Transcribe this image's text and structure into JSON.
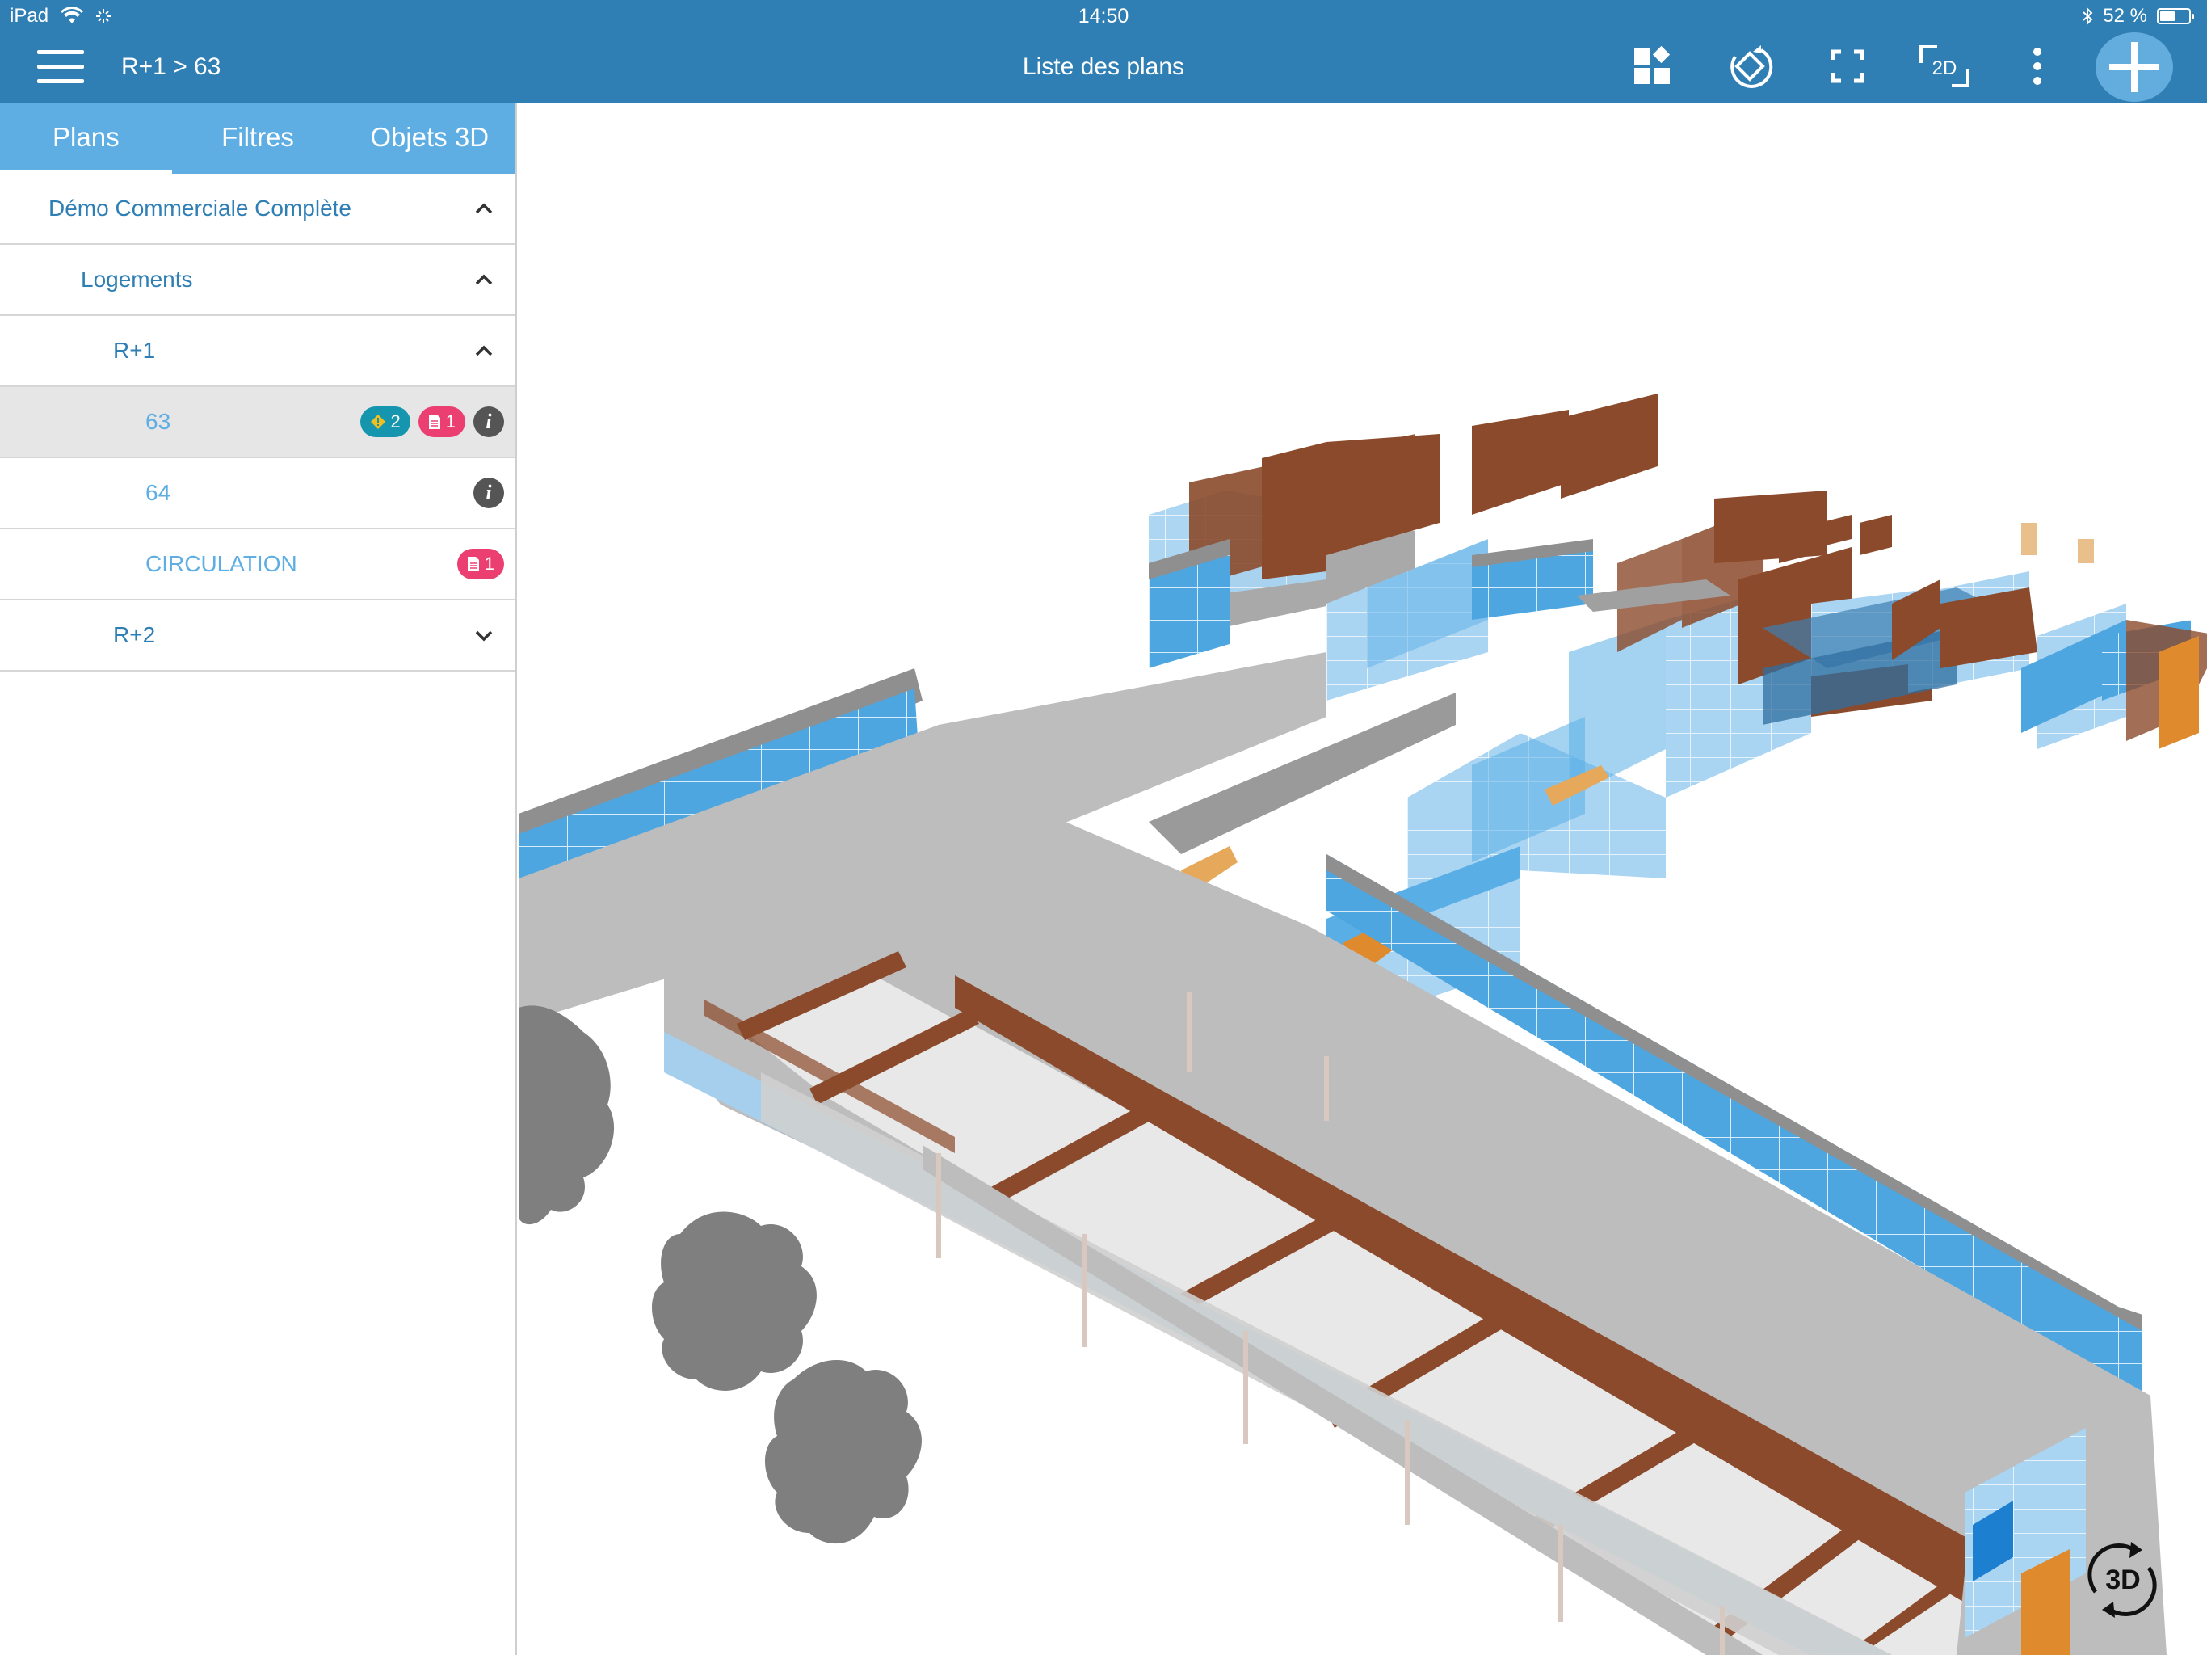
{
  "status": {
    "device": "iPad",
    "time": "14:50",
    "battery_text": "52 %",
    "battery_level": 0.52
  },
  "nav": {
    "breadcrumb": "R+1 > 63",
    "title": "Liste des plans"
  },
  "toolbar": {
    "icons": [
      "layers-icon",
      "rotate-icon",
      "fullscreen-icon",
      "view-2d-icon",
      "more-icon",
      "add-icon"
    ],
    "view_2d_label": "2D"
  },
  "sidebar": {
    "tabs": [
      {
        "label": "Plans",
        "active": true
      },
      {
        "label": "Filtres",
        "active": false
      },
      {
        "label": "Objets 3D",
        "active": false
      }
    ],
    "tree": [
      {
        "label": "Démo Commerciale Complète",
        "level": 0,
        "expanded": true
      },
      {
        "label": "Logements",
        "level": 1,
        "expanded": true
      },
      {
        "label": "R+1",
        "level": 2,
        "expanded": true
      },
      {
        "label": "63",
        "level": 3,
        "selected": true,
        "badges": {
          "observations": "2",
          "documents": "1"
        },
        "info": true
      },
      {
        "label": "64",
        "level": 3,
        "info": true
      },
      {
        "label": "CIRCULATION",
        "level": 3,
        "badges": {
          "documents": "1"
        }
      },
      {
        "label": "R+2",
        "level": 2,
        "expanded": false
      }
    ]
  },
  "viewport": {
    "mode_label": "3D"
  },
  "colors": {
    "nav_bar": "#2f7fb5",
    "tab_bar": "#5eaee4",
    "tree_text": "#2f7fb5",
    "badge_teal": "#1596ae",
    "badge_pink": "#ec3f71",
    "glass": "#5aaee6",
    "wood": "#8b4a2b",
    "floor": "#e5e5e5"
  }
}
